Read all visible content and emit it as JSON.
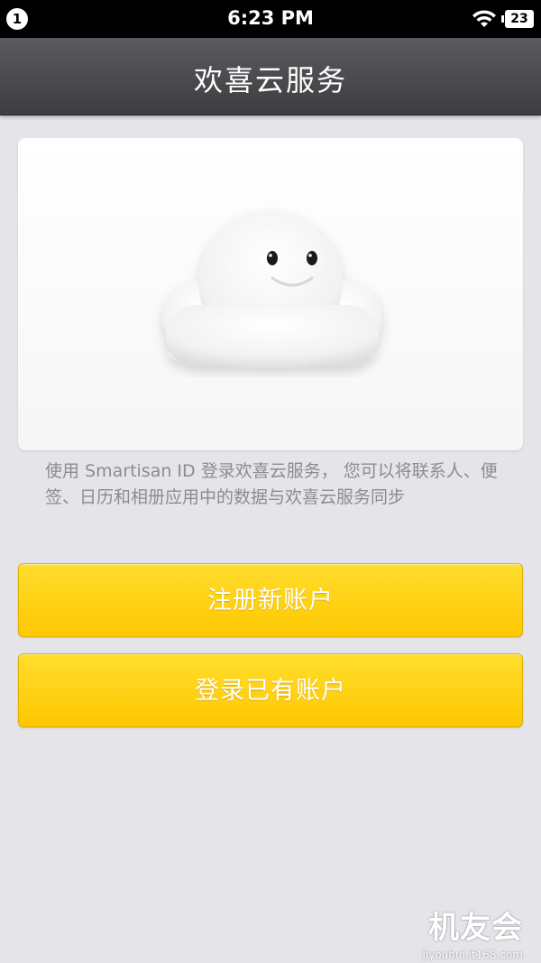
{
  "status_bar": {
    "badge": "1",
    "time": "6:23 PM",
    "battery": "23",
    "icons": [
      "notification-badge",
      "wifi-icon",
      "battery-icon"
    ]
  },
  "header": {
    "title": "欢喜云服务"
  },
  "hero": {
    "illustration": "cloud-mascot-icon"
  },
  "main": {
    "description": "使用 Smartisan ID 登录欢喜云服务， 您可以将联系人、便签、日历和相册应用中的数据与欢喜云服务同步",
    "register_button": "注册新账户",
    "login_button": "登录已有账户"
  },
  "watermark": {
    "logo": "机友会",
    "url": "jiyouhui.it168.com"
  },
  "colors": {
    "background": "#e4e4e9",
    "navbar": "#4a4a4d",
    "button": "#ffd000",
    "description_text": "#8c8c90"
  }
}
